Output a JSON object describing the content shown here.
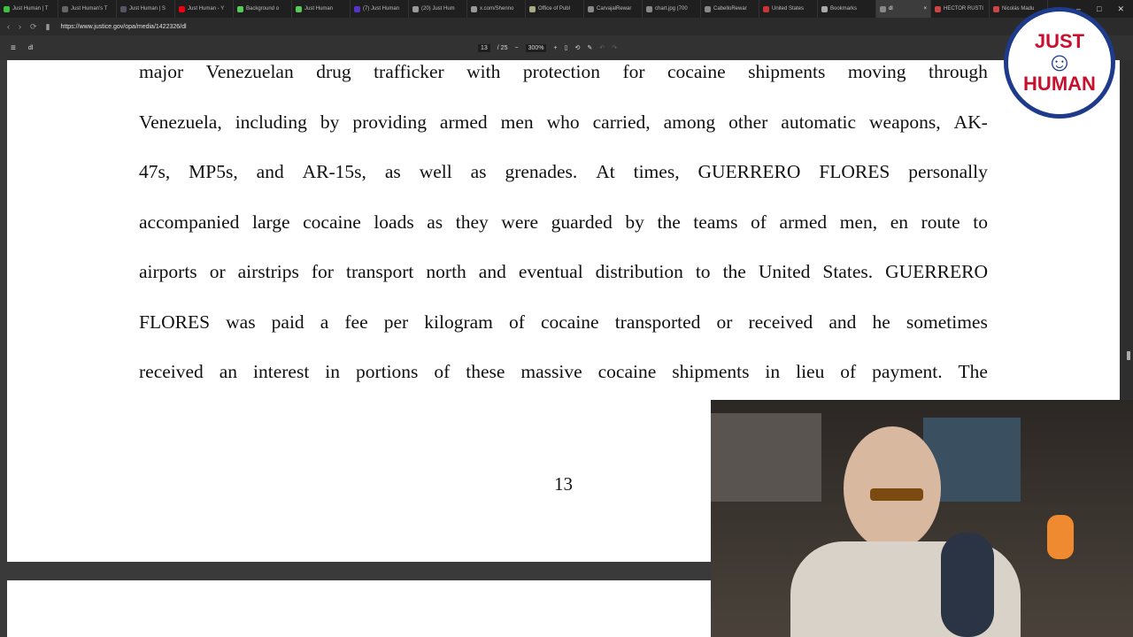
{
  "tabs": [
    {
      "label": "Just Human | T",
      "color": "#3fbf3f"
    },
    {
      "label": "Just Human's T",
      "color": "#666"
    },
    {
      "label": "Just Human | S",
      "color": "#556"
    },
    {
      "label": "Just Human - Y",
      "color": "#e01"
    },
    {
      "label": "Background o",
      "color": "#5c5"
    },
    {
      "label": "Just Human",
      "color": "#5c5"
    },
    {
      "label": "(7) Just Human",
      "color": "#53c"
    },
    {
      "label": "(20) Just Hum",
      "color": "#999"
    },
    {
      "label": "x.com/Shenno",
      "color": "#999"
    },
    {
      "label": "Office of Publ",
      "color": "#aa8"
    },
    {
      "label": "CarvajalRewar",
      "color": "#888"
    },
    {
      "label": "chart.jpg (700",
      "color": "#888"
    },
    {
      "label": "CabelloRewar",
      "color": "#888"
    },
    {
      "label": "United States",
      "color": "#c33"
    },
    {
      "label": "Bookmarks",
      "color": "#aaa"
    },
    {
      "label": "dl",
      "color": "#888",
      "active": true
    },
    {
      "label": "HECTOR RUSTI",
      "color": "#c44"
    },
    {
      "label": "Nicolás Madu",
      "color": "#c44"
    }
  ],
  "address": {
    "url": "https://www.justice.gov/opa/media/1422326/dl"
  },
  "pdf": {
    "title": "dl",
    "page": "13",
    "total": "/ 25",
    "zoom": "300%"
  },
  "document": {
    "lines": [
      "major Venezuelan drug trafficker with protection for cocaine shipments moving through",
      "Venezuela, including by providing armed men who carried, among other automatic weapons, AK-",
      "47s, MP5s, and AR-15s, as well as grenades. At times, GUERRERO FLORES personally",
      "accompanied large cocaine loads as they were guarded by the teams of armed men, en route to",
      "airports or airstrips for transport north and eventual distribution to the United States. GUERRERO",
      "FLORES was paid a fee per kilogram of cocaine transported or received and he sometimes",
      "received an interest in portions of these massive cocaine shipments in lieu of payment. The"
    ],
    "page_number": "13"
  },
  "logo": {
    "top": "JUST",
    "bottom": "HUMAN"
  }
}
